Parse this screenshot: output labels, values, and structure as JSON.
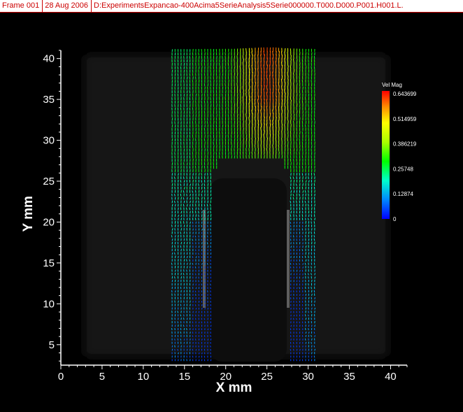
{
  "header": {
    "frame_label": "Frame 001",
    "date": "28 Aug 2006",
    "path": "D:ExperimentsExpancao-400Acima5SerieAnalysis5Serie000000.T000.D000.P001.H001.L."
  },
  "chart_data": {
    "type": "vector-field",
    "xlabel": "X mm",
    "ylabel": "Y mm",
    "xlim": [
      0,
      42
    ],
    "ylim": [
      2.5,
      41
    ],
    "xticks": [
      0,
      5,
      10,
      15,
      20,
      25,
      30,
      35,
      40
    ],
    "yticks": [
      5,
      10,
      15,
      20,
      25,
      30,
      35,
      40
    ],
    "field_x_range": [
      13.5,
      31
    ],
    "field_y_range": [
      3,
      41
    ],
    "jet_center_x": 25,
    "legend": {
      "title": "Vel Mag",
      "labels": [
        "0.643699",
        "0.514959",
        "0.386219",
        "0.25748",
        "0.12874",
        "0"
      ],
      "min": 0,
      "max": 0.643699
    },
    "colors": {
      "background": "#000000",
      "axes": "#ffffff",
      "header_text": "#cc0000",
      "colormap": [
        "#0000ff",
        "#00aaff",
        "#00ffcc",
        "#00ff00",
        "#aaff00",
        "#ffff00",
        "#ff8800",
        "#ff0000"
      ]
    }
  }
}
